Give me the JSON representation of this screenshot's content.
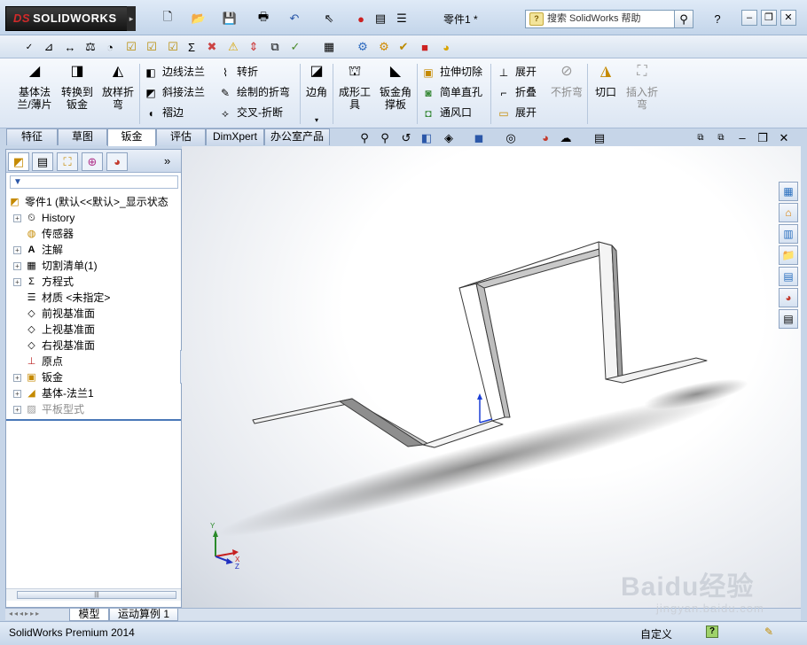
{
  "app": {
    "logo_text": "SOLIDWORKS",
    "logo_mark": "DS",
    "document_title": "零件1 *"
  },
  "search": {
    "placeholder": "搜索 SolidWorks 帮助"
  },
  "command_manager": {
    "base_flange": "基体法\n兰/薄片",
    "convert_to_sheet_metal": "转换到\n钣金",
    "lofted_bend": "放样折\n弯",
    "edge_flange": "边线法兰",
    "miter_flange": "斜接法兰",
    "hem": "褶边",
    "jog": "转折",
    "sketched_bend": "绘制的折弯",
    "cross_break": "交叉-折断",
    "corners": "边角",
    "forming_tool": "成形工\n具",
    "sheet_metal_gusset": "钣金角\n撑板",
    "extruded_cut": "拉伸切除",
    "simple_hole": "简单直孔",
    "vent": "通风口",
    "unfold": "展开",
    "fold": "折叠",
    "flatten": "展开",
    "no_bends": "不折弯",
    "rip": "切口",
    "insert_bends": "插入折\n弯"
  },
  "tabs": [
    {
      "label": "特征"
    },
    {
      "label": "草图"
    },
    {
      "label": "钣金"
    },
    {
      "label": "评估"
    },
    {
      "label": "DimXpert"
    },
    {
      "label": "办公室产品"
    }
  ],
  "active_tab": "钣金",
  "feature_tree": {
    "filter_icon": "filter-icon",
    "root": "零件1 (默认<<默认>_显示状态",
    "nodes": [
      {
        "label": "History",
        "icon": "history-icon"
      },
      {
        "label": "传感器",
        "icon": "sensor-icon"
      },
      {
        "label": "注解",
        "icon": "annotation-icon"
      },
      {
        "label": "切割清单(1)",
        "icon": "cutlist-icon"
      },
      {
        "label": "方程式",
        "icon": "equation-icon"
      },
      {
        "label": "材质 <未指定>",
        "icon": "material-icon"
      },
      {
        "label": "前视基准面",
        "icon": "plane-icon"
      },
      {
        "label": "上视基准面",
        "icon": "plane-icon"
      },
      {
        "label": "右视基准面",
        "icon": "plane-icon"
      },
      {
        "label": "原点",
        "icon": "origin-icon"
      },
      {
        "label": "钣金",
        "icon": "sheetmetal-icon"
      },
      {
        "label": "基体-法兰1",
        "icon": "base-flange-icon"
      },
      {
        "label": "平板型式",
        "icon": "flat-pattern-icon"
      }
    ]
  },
  "bottom_tabs": [
    {
      "label": "模型"
    },
    {
      "label": "运动算例 1"
    }
  ],
  "triad": {
    "x_label": "X",
    "y_label": "Y",
    "z_label": "Z"
  },
  "status": {
    "product": "SolidWorks Premium 2014",
    "units": "自定义",
    "help_icon": "?"
  },
  "watermark": {
    "text": "Baidu经验",
    "sub": "jingyan.baidu.com"
  },
  "colors": {
    "accent": "#c6d5e8",
    "logo_bg": "#1f1f1f",
    "viewport_bg": "#ffffff"
  }
}
